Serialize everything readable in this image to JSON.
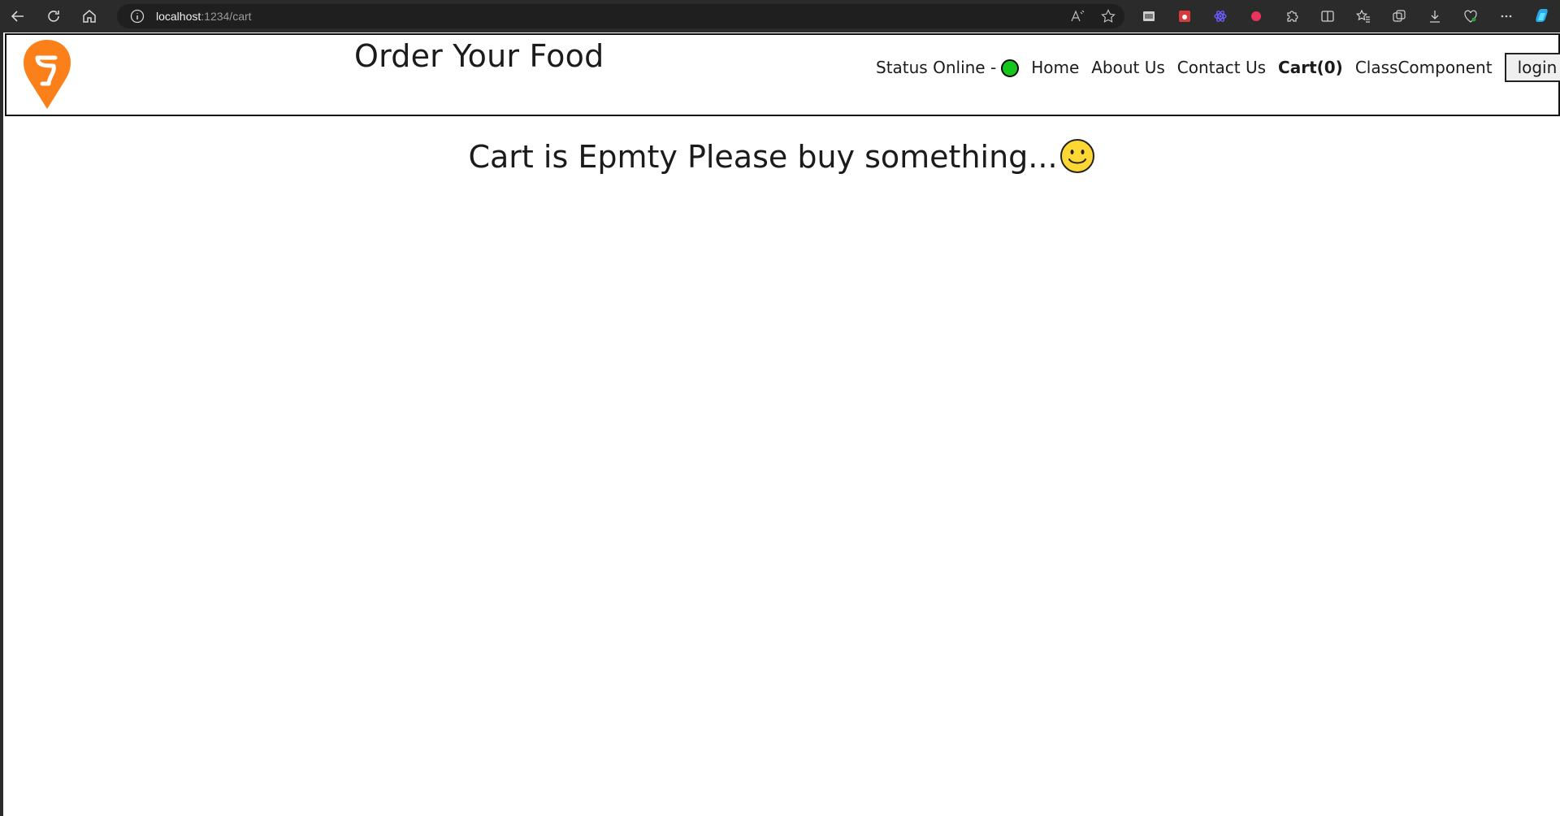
{
  "browser": {
    "url_host": "localhost",
    "url_path": ":1234/cart"
  },
  "header": {
    "title": "Order Your Food",
    "status_label": "Status Online -",
    "status_color": "#14c71a",
    "brand_color": "#fc8019",
    "nav": {
      "home": "Home",
      "about": "About Us",
      "contact": "Contact Us",
      "cart": "Cart(0)",
      "class_component": "ClassComponent",
      "login": "login"
    }
  },
  "main": {
    "empty_message": "Cart is Epmty Please buy something..."
  }
}
